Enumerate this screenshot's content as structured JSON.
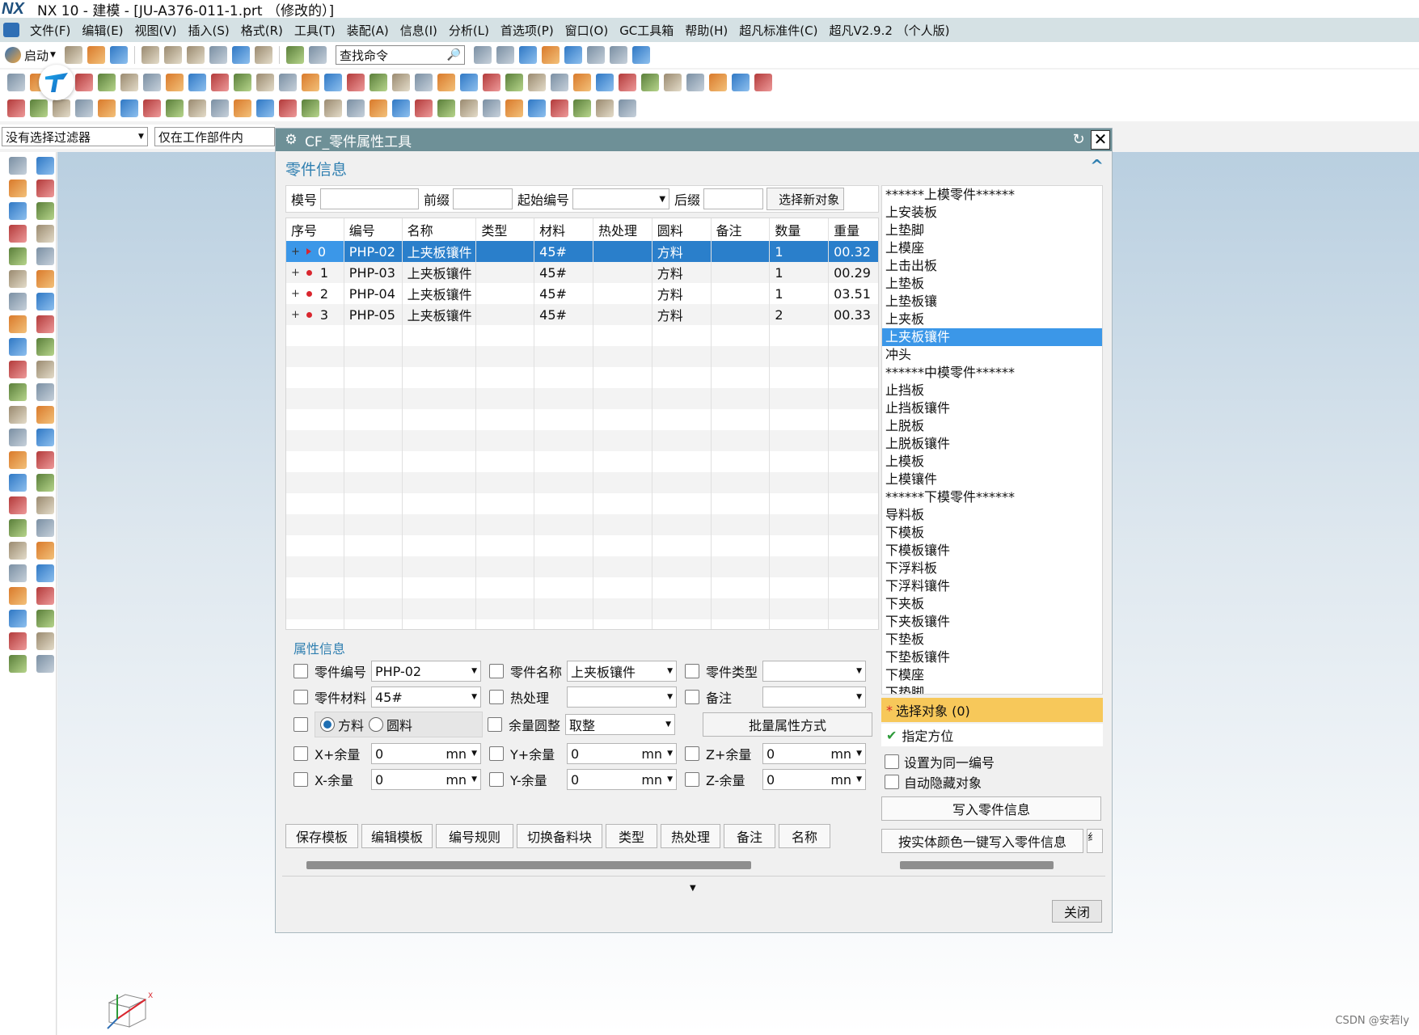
{
  "window": {
    "logo": "NX",
    "title": "NX 10 - 建模 - [JU-A376-011-1.prt （修改的）]"
  },
  "menu": [
    "文件(F)",
    "编辑(E)",
    "视图(V)",
    "插入(S)",
    "格式(R)",
    "工具(T)",
    "装配(A)",
    "信息(I)",
    "分析(L)",
    "首选项(P)",
    "窗口(O)",
    "GC工具箱",
    "帮助(H)",
    "超凡标准件(C)",
    "超凡V2.9.2 （个人版)"
  ],
  "toolbar": {
    "start_label": "启动",
    "search_placeholder": "查找命令",
    "search_icon": "🔎"
  },
  "filters": {
    "selection_filter": "没有选择过滤器",
    "scope": "仅在工作部件内"
  },
  "dialog": {
    "title": "CF_零件属性工具",
    "gear_icon": "⚙",
    "reset_icon": "↻",
    "close_icon": "✕",
    "section_part_info": "零件信息",
    "collapse_icon": "^",
    "inputs": {
      "mold_no_label": "模号",
      "prefix_label": "前缀",
      "start_no_label": "起始编号",
      "suffix_label": "后缀",
      "select_new_label": "选择新对象"
    },
    "table": {
      "columns": [
        "序号",
        "编号",
        "名称",
        "类型",
        "材料",
        "热处理",
        "圆料",
        "备注",
        "数量",
        "重量"
      ],
      "rows": [
        {
          "seq": "0",
          "code": "PHP-02",
          "name": "上夹板镶件",
          "type": "",
          "material": "45#",
          "heat": "",
          "stock": "方料",
          "note": "",
          "qty": "1",
          "weight": "00.32"
        },
        {
          "seq": "1",
          "code": "PHP-03",
          "name": "上夹板镶件",
          "type": "",
          "material": "45#",
          "heat": "",
          "stock": "方料",
          "note": "",
          "qty": "1",
          "weight": "00.29"
        },
        {
          "seq": "2",
          "code": "PHP-04",
          "name": "上夹板镶件",
          "type": "",
          "material": "45#",
          "heat": "",
          "stock": "方料",
          "note": "",
          "qty": "1",
          "weight": "03.51"
        },
        {
          "seq": "3",
          "code": "PHP-05",
          "name": "上夹板镶件",
          "type": "",
          "material": "45#",
          "heat": "",
          "stock": "方料",
          "note": "",
          "qty": "2",
          "weight": "00.33"
        }
      ],
      "selected_index": 0,
      "expand_glyph": "+"
    },
    "attr": {
      "title": "属性信息",
      "part_code_label": "零件编号",
      "part_code_value": "PHP-02",
      "part_name_label": "零件名称",
      "part_name_value": "上夹板镶件",
      "part_type_label": "零件类型",
      "part_type_value": "",
      "material_label": "零件材料",
      "material_value": "45#",
      "heat_label": "热处理",
      "heat_value": "",
      "note_label": "备注",
      "note_value": "",
      "square_label": "方料",
      "round_label": "圆料",
      "shape_selected": "方料",
      "rounding_label": "余量圆整",
      "rounding_value": "取整",
      "batch_btn": "批量属性方式",
      "xp_label": "X+余量",
      "xp_value": "0",
      "yp_label": "Y+余量",
      "yp_value": "0",
      "zp_label": "Z+余量",
      "zp_value": "0",
      "xm_label": "X-余量",
      "xm_value": "0",
      "ym_label": "Y-余量",
      "ym_value": "0",
      "zm_label": "Z-余量",
      "zm_value": "0",
      "unit": "mn",
      "dd_arrow": "▼"
    },
    "buttons": [
      "保存模板",
      "编辑模板",
      "编号规则",
      "切换备料块",
      "类型",
      "热处理",
      "备注",
      "名称"
    ],
    "footer_caret": "▼",
    "close_label": "关闭",
    "categories": [
      "******上模零件******",
      "上安装板",
      "上垫脚",
      "上模座",
      "上击出板",
      "上垫板",
      "上垫板镶",
      "上夹板",
      "上夹板镶件",
      "冲头",
      "******中模零件******",
      "止挡板",
      "止挡板镶件",
      "上脱板",
      "上脱板镶件",
      "上模板",
      "上模镶件",
      "******下模零件******",
      "导料板",
      "下模板",
      "下模板镶件",
      "下浮料板",
      "下浮料镶件",
      "下夹板",
      "下夹板镶件",
      "下垫板",
      "下垫板镶件",
      "下模座",
      "下垫脚"
    ],
    "selected_category": "上夹板镶件",
    "select_object": "选择对象 (0)",
    "select_object_star": "*",
    "specify_orientation": "指定方位",
    "check_glyph": "✔",
    "same_number_label": "设置为同一编号",
    "auto_hide_label": "自动隐藏对象",
    "write_info_btn": "写入零件信息",
    "color_write_btn": "按实体颜色一键写入零件信息",
    "color_write_btn_2": "纟"
  },
  "triad_label": "X",
  "watermark": "CSDN @安若ly",
  "colors": {
    "accent": "#3b97e8",
    "dialog_header": "#6e9097",
    "section_title": "#2f7fb0",
    "select_highlight": "#f7c85a",
    "bullet": "#d9262e"
  }
}
